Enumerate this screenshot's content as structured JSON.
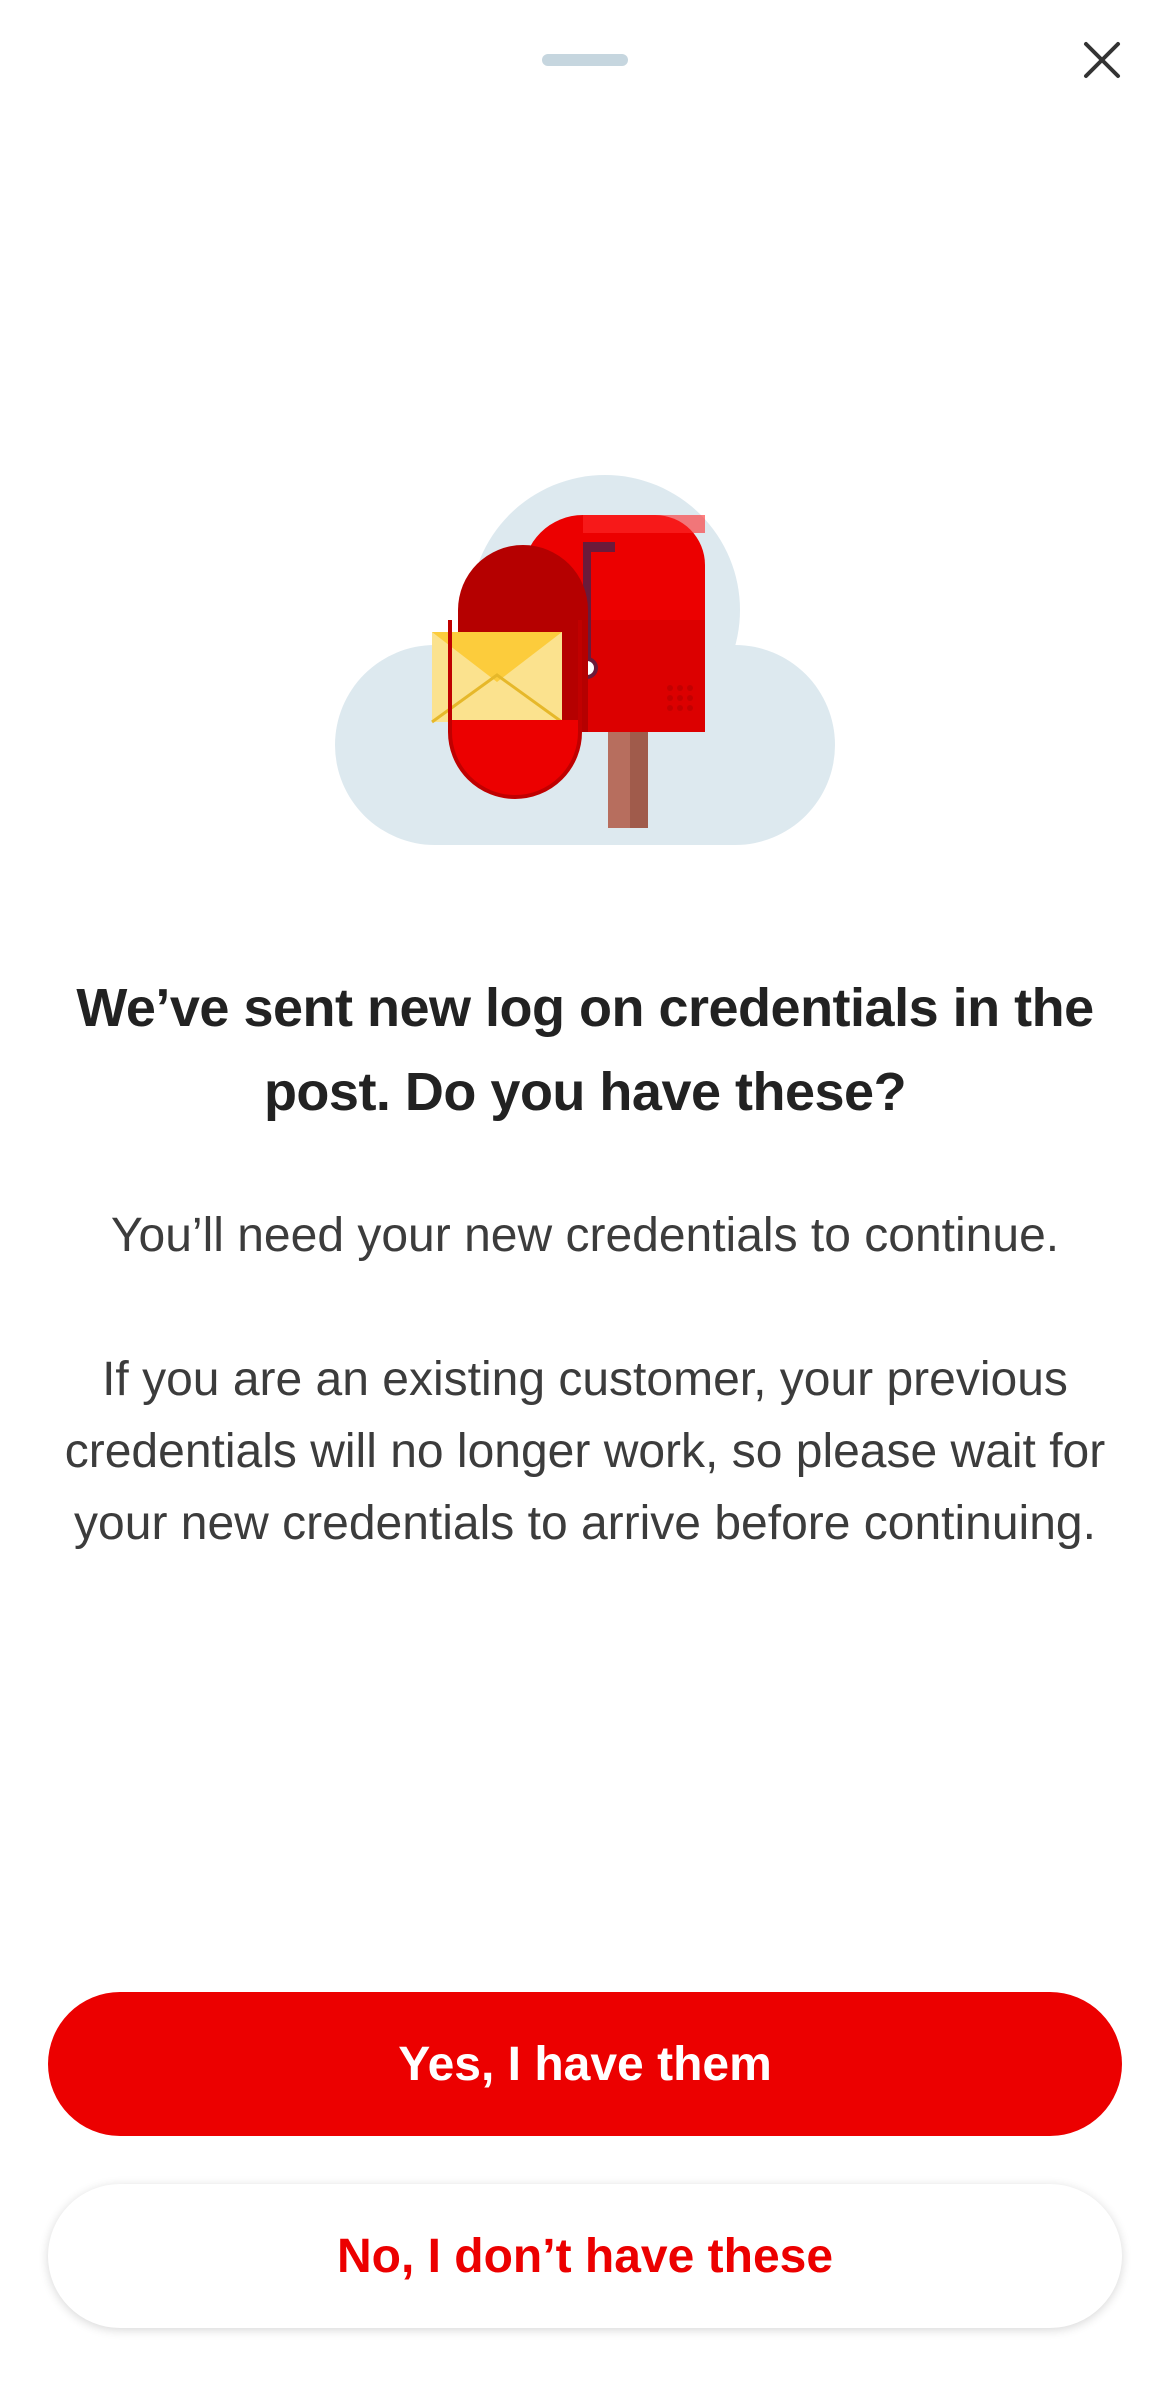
{
  "sheet": {
    "close_icon": "close-icon",
    "illustration_icon": "mailbox-with-letter-icon"
  },
  "content": {
    "title": "We’ve sent new log on credentials in the post. Do you have these?",
    "paragraph_1": "You’ll need your new credentials to continue.",
    "paragraph_2": "If you are an existing customer, your previous credentials will no longer work, so please wait for your new credentials to arrive before continuing."
  },
  "actions": {
    "primary_label": "Yes, I have them",
    "secondary_label": "No, I don’t have these"
  },
  "colors": {
    "brand_red": "#ec0000",
    "text_dark": "#222222",
    "text_body": "#3c3c3c",
    "cloud": "#dde9ef"
  }
}
